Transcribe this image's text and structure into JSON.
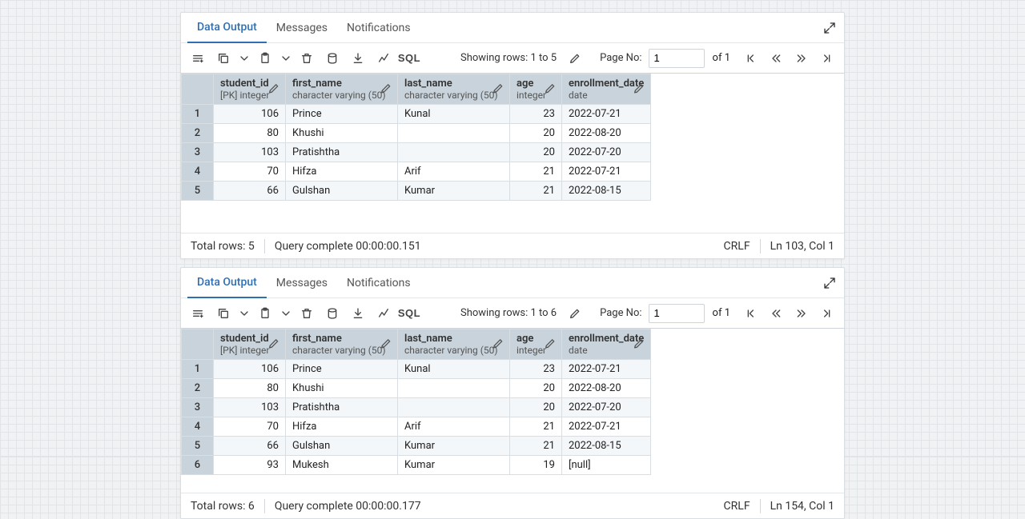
{
  "panels": [
    {
      "tabs": {
        "data_output": "Data Output",
        "messages": "Messages",
        "notifications": "Notifications"
      },
      "toolbar": {
        "showing": "Showing rows: 1 to 5",
        "page_label": "Page No:",
        "page_value": "1",
        "of_total": "of 1"
      },
      "columns": [
        {
          "name": "student_id",
          "type": "[PK] integer"
        },
        {
          "name": "first_name",
          "type": "character varying (50)"
        },
        {
          "name": "last_name",
          "type": "character varying (50)"
        },
        {
          "name": "age",
          "type": "integer"
        },
        {
          "name": "enrollment_date",
          "type": "date"
        }
      ],
      "rows": [
        {
          "n": "1",
          "student_id": "106",
          "first_name": "Prince",
          "last_name": "Kunal",
          "age": "23",
          "enrollment_date": "2022-07-21"
        },
        {
          "n": "2",
          "student_id": "80",
          "first_name": "Khushi",
          "last_name": "",
          "age": "20",
          "enrollment_date": "2022-08-20"
        },
        {
          "n": "3",
          "student_id": "103",
          "first_name": "Pratishtha",
          "last_name": "",
          "age": "20",
          "enrollment_date": "2022-07-20"
        },
        {
          "n": "4",
          "student_id": "70",
          "first_name": "Hifza",
          "last_name": "Arif",
          "age": "21",
          "enrollment_date": "2022-07-21"
        },
        {
          "n": "5",
          "student_id": "66",
          "first_name": "Gulshan",
          "last_name": "Kumar",
          "age": "21",
          "enrollment_date": "2022-08-15"
        }
      ],
      "status": {
        "total": "Total rows: 5",
        "timing": "Query complete 00:00:00.151",
        "crlf": "CRLF",
        "caret": "Ln 103, Col 1"
      },
      "grid_pad": 40
    },
    {
      "tabs": {
        "data_output": "Data Output",
        "messages": "Messages",
        "notifications": "Notifications"
      },
      "toolbar": {
        "showing": "Showing rows: 1 to 6",
        "page_label": "Page No:",
        "page_value": "1",
        "of_total": "of 1"
      },
      "columns": [
        {
          "name": "student_id",
          "type": "[PK] integer"
        },
        {
          "name": "first_name",
          "type": "character varying (50)"
        },
        {
          "name": "last_name",
          "type": "character varying (50)"
        },
        {
          "name": "age",
          "type": "integer"
        },
        {
          "name": "enrollment_date",
          "type": "date"
        }
      ],
      "rows": [
        {
          "n": "1",
          "student_id": "106",
          "first_name": "Prince",
          "last_name": "Kunal",
          "age": "23",
          "enrollment_date": "2022-07-21"
        },
        {
          "n": "2",
          "student_id": "80",
          "first_name": "Khushi",
          "last_name": "",
          "age": "20",
          "enrollment_date": "2022-08-20"
        },
        {
          "n": "3",
          "student_id": "103",
          "first_name": "Pratishtha",
          "last_name": "",
          "age": "20",
          "enrollment_date": "2022-07-20"
        },
        {
          "n": "4",
          "student_id": "70",
          "first_name": "Hifza",
          "last_name": "Arif",
          "age": "21",
          "enrollment_date": "2022-07-21"
        },
        {
          "n": "5",
          "student_id": "66",
          "first_name": "Gulshan",
          "last_name": "Kumar",
          "age": "21",
          "enrollment_date": "2022-08-15"
        },
        {
          "n": "6",
          "student_id": "93",
          "first_name": "Mukesh",
          "last_name": "Kumar",
          "age": "19",
          "enrollment_date": "[null]"
        }
      ],
      "status": {
        "total": "Total rows: 6",
        "timing": "Query complete 00:00:00.177",
        "crlf": "CRLF",
        "caret": "Ln 154, Col 1"
      },
      "grid_pad": 22
    }
  ],
  "icons": {
    "sql": "SQL"
  }
}
